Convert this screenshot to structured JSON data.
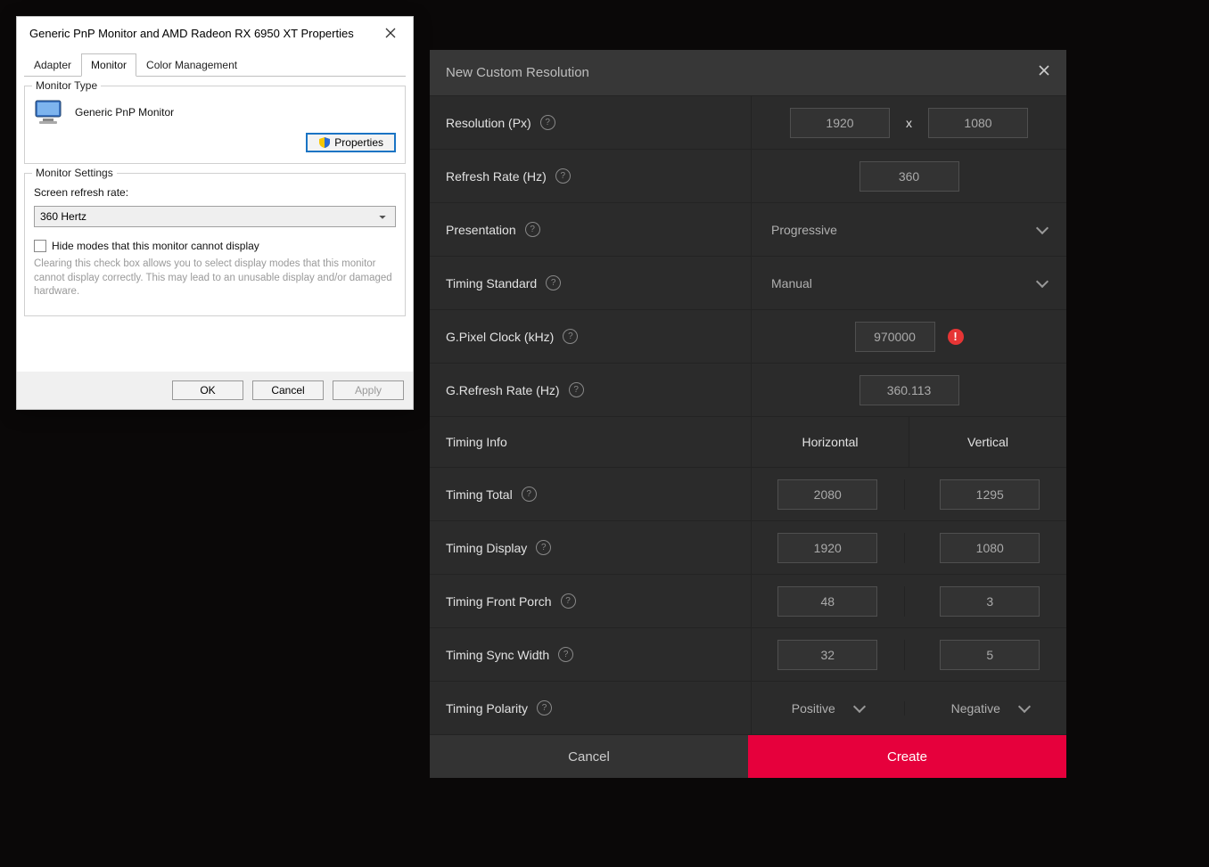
{
  "win": {
    "title": "Generic PnP Monitor and AMD Radeon RX 6950 XT Properties",
    "tabs": {
      "adapter": "Adapter",
      "monitor": "Monitor",
      "color": "Color Management"
    },
    "group_monitor_type": "Monitor Type",
    "monitor_name": "Generic PnP Monitor",
    "properties_btn": "Properties",
    "group_monitor_settings": "Monitor Settings",
    "refresh_label": "Screen refresh rate:",
    "refresh_value": "360 Hertz",
    "hide_modes_label": "Hide modes that this monitor cannot display",
    "hint": "Clearing this check box allows you to select display modes that this monitor cannot display correctly. This may lead to an unusable display and/or damaged hardware.",
    "ok": "OK",
    "cancel": "Cancel",
    "apply": "Apply"
  },
  "amd": {
    "title": "New Custom Resolution",
    "labels": {
      "resolution": "Resolution (Px)",
      "refresh": "Refresh Rate (Hz)",
      "presentation": "Presentation",
      "timing_standard": "Timing Standard",
      "pixel_clock": "G.Pixel Clock (kHz)",
      "g_refresh": "G.Refresh Rate (Hz)",
      "timing_info": "Timing Info",
      "horizontal": "Horizontal",
      "vertical": "Vertical",
      "timing_total": "Timing Total",
      "timing_display": "Timing Display",
      "timing_front_porch": "Timing Front Porch",
      "timing_sync_width": "Timing Sync Width",
      "timing_polarity": "Timing Polarity"
    },
    "values": {
      "res_w": "1920",
      "res_h": "1080",
      "res_sep": "x",
      "refresh": "360",
      "presentation": "Progressive",
      "timing_standard": "Manual",
      "pixel_clock": "970000",
      "g_refresh": "360.113",
      "total_h": "2080",
      "total_v": "1295",
      "display_h": "1920",
      "display_v": "1080",
      "fp_h": "48",
      "fp_v": "3",
      "sw_h": "32",
      "sw_v": "5",
      "pol_h": "Positive",
      "pol_v": "Negative"
    },
    "error_glyph": "!",
    "footer": {
      "cancel": "Cancel",
      "create": "Create"
    }
  }
}
